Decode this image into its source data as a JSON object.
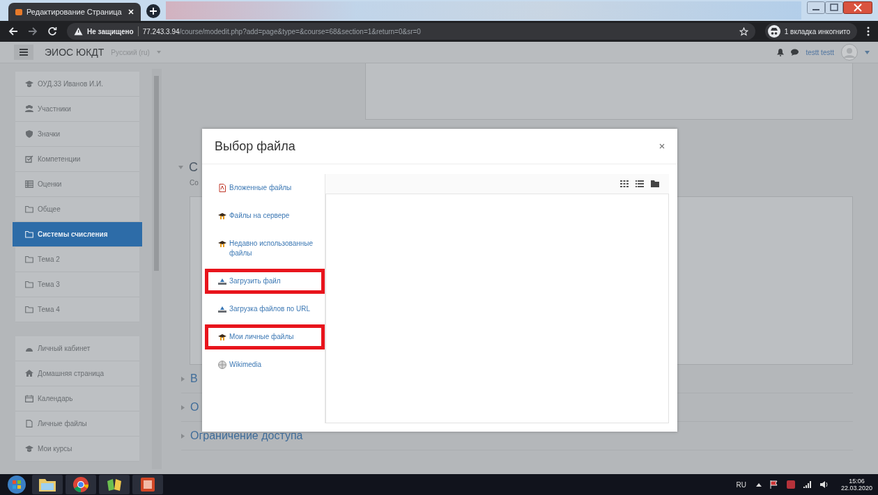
{
  "browser": {
    "tab_title": "Редактирование Страница",
    "security": "Не защищено",
    "url_host": "77.243.3.94",
    "url_path": "/course/modedit.php?add=page&type=&course=68&section=1&return=0&sr=0",
    "incognito": "1 вкладка инкогнито"
  },
  "navbar": {
    "site_name": "ЭИОС ЮКДТ",
    "language": "Русский (ru)",
    "user": "testt testt"
  },
  "sidebar": {
    "groups": [
      [
        {
          "label": "ОУД.33 Иванов И.И.",
          "kind": "cap",
          "selected": false
        },
        {
          "label": "Участники",
          "kind": "users",
          "selected": false
        },
        {
          "label": "Значки",
          "kind": "shield",
          "selected": false
        },
        {
          "label": "Компетенции",
          "kind": "check",
          "selected": false
        },
        {
          "label": "Оценки",
          "kind": "table",
          "selected": false
        },
        {
          "label": "Общее",
          "kind": "folder",
          "selected": false
        },
        {
          "label": "Системы счисления",
          "kind": "folder",
          "selected": true
        },
        {
          "label": "Тема 2",
          "kind": "folder",
          "selected": false
        },
        {
          "label": "Тема 3",
          "kind": "folder",
          "selected": false
        },
        {
          "label": "Тема 4",
          "kind": "folder",
          "selected": false
        }
      ],
      [
        {
          "label": "Личный кабинет",
          "kind": "gauge",
          "selected": false
        },
        {
          "label": "Домашняя страница",
          "kind": "home",
          "selected": false
        },
        {
          "label": "Календарь",
          "kind": "calendar",
          "selected": false
        },
        {
          "label": "Личные файлы",
          "kind": "file",
          "selected": false
        },
        {
          "label": "Мои курсы",
          "kind": "cap",
          "selected": false
        }
      ]
    ]
  },
  "main": {
    "section_title": "С",
    "section_text": "Со",
    "sections": [
      "В",
      "О",
      "Ограничение доступа"
    ]
  },
  "dialog": {
    "title": "Выбор файла",
    "repositories": [
      {
        "label": "Вложенные файлы",
        "kind": "pdf",
        "highlighted": false
      },
      {
        "label": "Файлы на сервере",
        "kind": "repo",
        "highlighted": false
      },
      {
        "label": "Недавно использованные файлы",
        "kind": "repo",
        "highlighted": false
      },
      {
        "label": "Загрузить файл",
        "kind": "upload",
        "highlighted": true
      },
      {
        "label": "Загрузка файлов по URL",
        "kind": "upload",
        "highlighted": false
      },
      {
        "label": "Мои личные файлы",
        "kind": "repo",
        "highlighted": true
      },
      {
        "label": "Wikimedia",
        "kind": "globe",
        "highlighted": false
      }
    ]
  },
  "taskbar": {
    "language": "RU",
    "time": "15:06",
    "date": "22.03.2020"
  }
}
